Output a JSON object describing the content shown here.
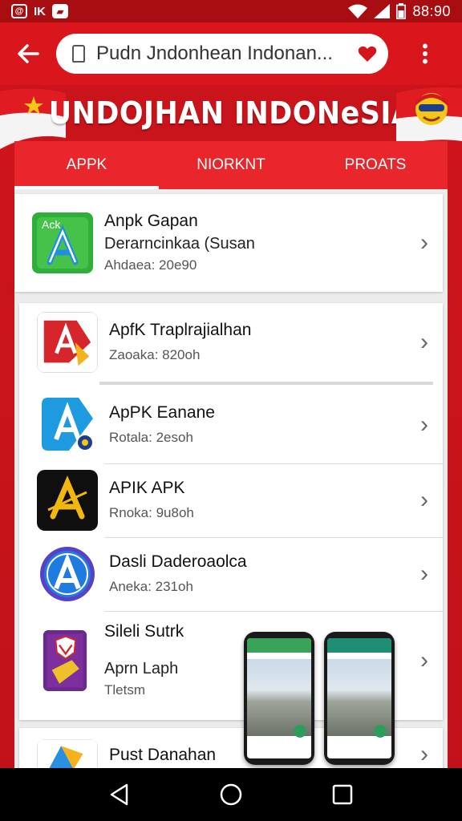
{
  "status_bar": {
    "time": "88:90",
    "left_icons": [
      "notification-icon",
      "ik-icon",
      "image-icon"
    ],
    "right_icons": [
      "wifi-icon",
      "signal-icon",
      "battery-icon"
    ]
  },
  "browser": {
    "url": "Pudn Jndonhean Indonan...",
    "back_icon": "back-arrow-icon",
    "menu_icon": "overflow-menu-icon",
    "favorite_icon": "heart-icon"
  },
  "banner": {
    "title": "UNDOJHAN INDONeSIA"
  },
  "tabs": [
    {
      "label": "APPK",
      "active": true
    },
    {
      "label": "NIORKNT",
      "active": false
    },
    {
      "label": "PROATS",
      "active": false
    }
  ],
  "apps": [
    {
      "name": "Anpk Gapan",
      "line2": "Derarncinkaa (Susan",
      "meta": "Ahdaea: 20e90",
      "icon": "apk-green-store-icon"
    },
    {
      "name": "ApfK Traplrajialhan",
      "meta": "Zaoaka: 820oh",
      "icon": "red-a-icon"
    },
    {
      "name": "ApPK Eanane",
      "meta": "Rotala: 2esoh",
      "icon": "blue-a-icon"
    },
    {
      "name": "APIK APK",
      "meta": "Rnoka: 9u8oh",
      "icon": "black-gold-a-icon"
    },
    {
      "name": "Dasli Daderoaolca",
      "meta": "Aneka: 231oh",
      "icon": "circle-a-icon"
    },
    {
      "name": "Sileli Sutrk",
      "line2": "Aprn Laph",
      "meta": "Tletsm",
      "icon": "purple-shield-icon"
    },
    {
      "name": "Pust Danahan",
      "icon": "play-triangle-icon"
    }
  ],
  "colors": {
    "brand_red": "#d8161c",
    "tab_red": "#e8262b"
  },
  "nav": {
    "back": "nav-back-icon",
    "home": "nav-home-icon",
    "recents": "nav-recents-icon"
  }
}
